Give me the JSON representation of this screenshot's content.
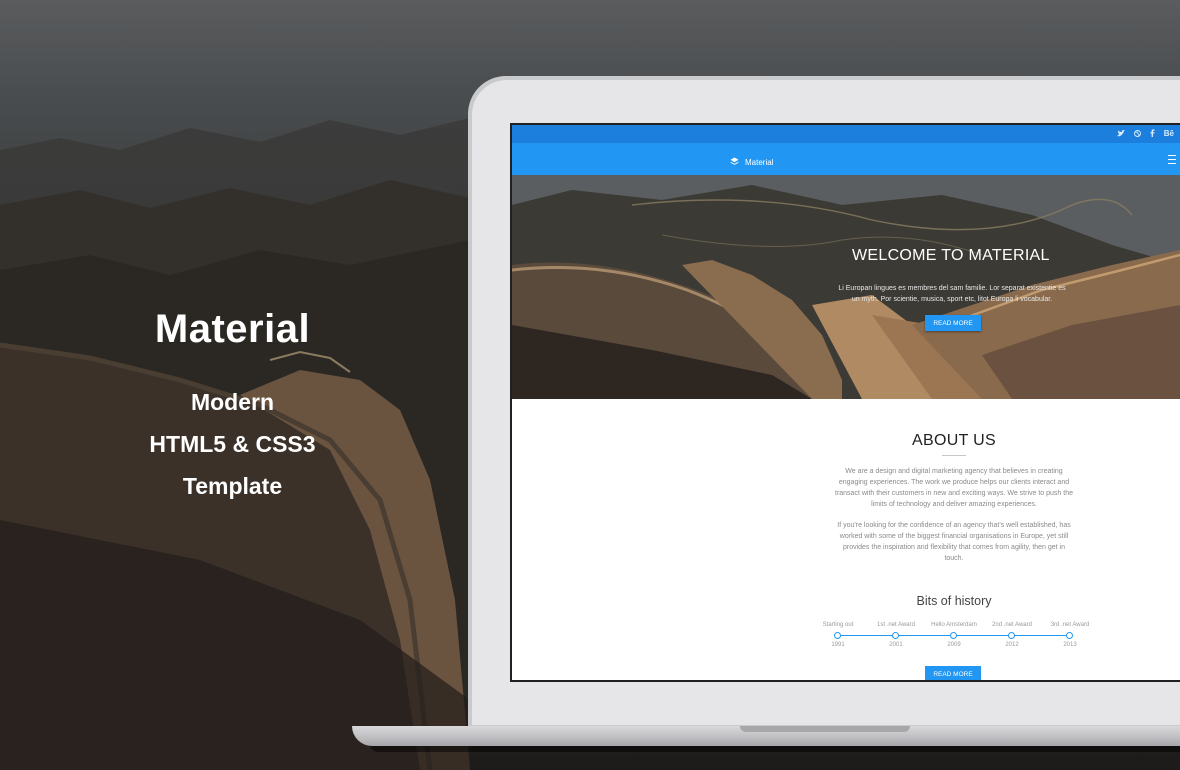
{
  "promo": {
    "title": "Material",
    "line1": "Modern",
    "line2": "HTML5 & CSS3",
    "line3": "Template"
  },
  "site": {
    "social_icons": [
      "twitter-icon",
      "dribbble-icon",
      "facebook-icon",
      "behance-icon"
    ],
    "social_behance_label": "Bē",
    "brand": "Material",
    "hero": {
      "title": "WELCOME TO MATERIAL",
      "text": "Li Europan lingues es membres del sam familie. Lor separat existentie es un myth. Por scientie, musica, sport etc, litot Europa li vocabular.",
      "button": "READ MORE"
    },
    "about": {
      "title": "ABOUT US",
      "p1": "We are a design and digital marketing agency that believes in creating engaging experiences. The work we produce helps our clients interact and transact with their customers in new and exciting ways. We strive to push the limits of technology and deliver amazing experiences.",
      "p2": "If you're looking for the confidence of an agency that's well established, has worked with some of the biggest financial organisations in Europe, yet still provides the inspiration and flexibility that comes from agility, then get in touch."
    },
    "history": {
      "title": "Bits of history",
      "events": [
        {
          "label": "Starting out",
          "year": "1991"
        },
        {
          "label": "1st .net Award",
          "year": "2001"
        },
        {
          "label": "Hello Amsterdam",
          "year": "2009"
        },
        {
          "label": "2nd .net Award",
          "year": "2012"
        },
        {
          "label": "3rd .net Award",
          "year": "2013"
        }
      ]
    },
    "more_button": "READ MORE",
    "colors": {
      "primary": "#2196f3",
      "topbar": "#1c7fde"
    }
  }
}
